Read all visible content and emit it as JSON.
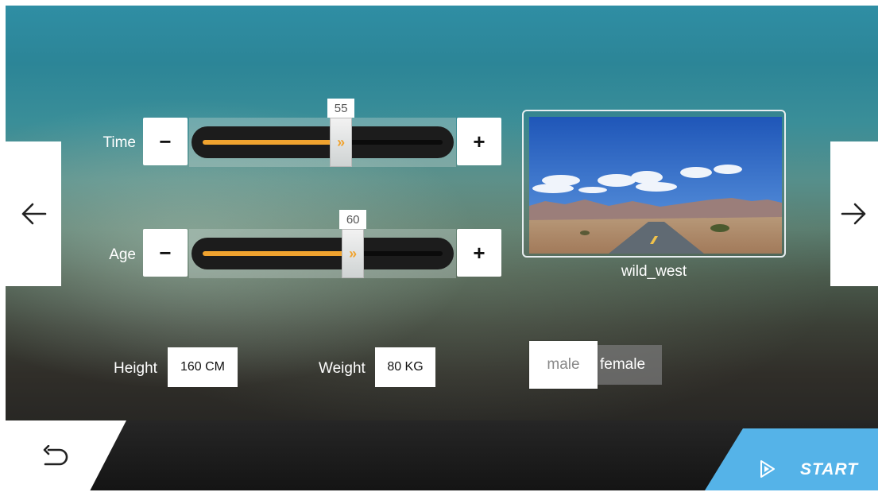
{
  "navigation": {
    "prev_icon": "arrow-left-icon",
    "next_icon": "arrow-right-icon"
  },
  "time": {
    "label": "Time",
    "value": "55",
    "fraction": 0.55,
    "minus": "−",
    "plus": "+"
  },
  "age": {
    "label": "Age",
    "value": "60",
    "fraction": 0.6,
    "minus": "−",
    "plus": "+"
  },
  "slider": {
    "thumb_glyph": "»",
    "fill_color": "#f0a32f"
  },
  "scene": {
    "name": "wild_west"
  },
  "height": {
    "label": "Height",
    "value": "160 CM"
  },
  "weight": {
    "label": "Weight",
    "value": "80 KG"
  },
  "gender": {
    "options": [
      "male",
      "female"
    ],
    "female_visible_text": "female",
    "selected": "male"
  },
  "footer": {
    "back_icon": "undo-arrow-icon",
    "start_icon": "play-outline-icon",
    "start_label": "START",
    "start_color": "#55b3e8"
  }
}
